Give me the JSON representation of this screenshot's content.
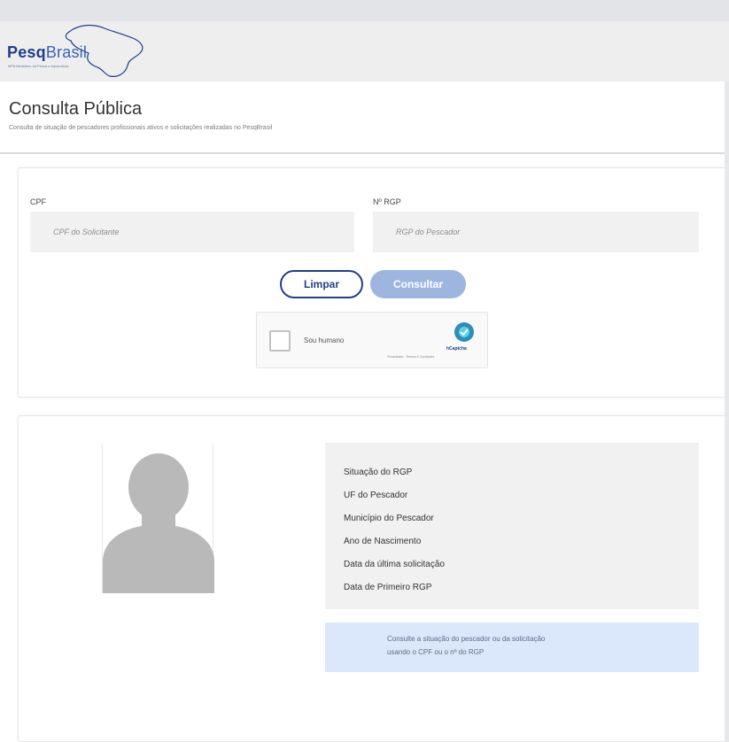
{
  "header": {
    "logo_bold": "Pesq",
    "logo_light": "Brasil",
    "logo_tagline": "MPA Ministério da Pesca e Aquicultura"
  },
  "page": {
    "title": "Consulta Pública",
    "subtitle": "Consulta de situação de pescadores profissionais ativos e solicitações realizadas no PesqBrasil"
  },
  "search": {
    "cpf_label": "CPF",
    "cpf_placeholder": "CPF do Solicitante",
    "rgp_label": "Nº RGP",
    "rgp_placeholder": "RGP do Pescador",
    "clear_label": "Limpar",
    "submit_label": "Consultar"
  },
  "captcha": {
    "label": "Sou humano",
    "brand": "hCaptcha",
    "terms": "Privacidade · Termos e Condições"
  },
  "result": {
    "fields": [
      "Situação do RGP",
      "UF do Pescador",
      "Município do Pescador",
      "Ano de Nascimento",
      "Data da última solicitação",
      "Data de Primeiro RGP"
    ],
    "note_line1": "Consulte a situação do pescador ou da solicitação",
    "note_line2": "usando o CPF ou o nº do RGP"
  },
  "colors": {
    "brand": "#1f3f8a",
    "submit_disabled": "#9db6e0",
    "note_bg": "#dbe8fb"
  }
}
